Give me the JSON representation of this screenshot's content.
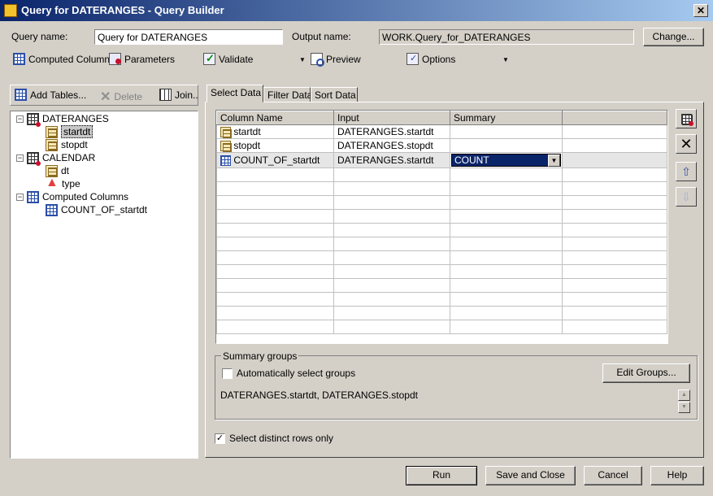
{
  "window": {
    "title": "Query for DATERANGES - Query Builder",
    "close": "✕"
  },
  "query": {
    "name_label": "Query name:",
    "name_value": "Query for DATERANGES",
    "output_label": "Output name:",
    "output_value": "WORK.Query_for_DATERANGES",
    "change_label": "Change..."
  },
  "toolbar": {
    "computed": "Computed Columns",
    "parameters": "Parameters",
    "validate": "Validate",
    "preview": "Preview",
    "options": "Options"
  },
  "left_toolbar": {
    "add": "Add Tables...",
    "delete": "Delete",
    "join": "Join.."
  },
  "tree": {
    "daterange": "DATERANGES",
    "startdt": "startdt",
    "stopdt": "stopdt",
    "calendar": "CALENDAR",
    "dt": "dt",
    "type": "type",
    "computed": "Computed Columns",
    "count": "COUNT_OF_startdt"
  },
  "tabs": {
    "select": "Select Data",
    "filter": "Filter Data",
    "sort": "Sort Data"
  },
  "grid": {
    "headers": [
      "Column Name",
      "Input",
      "Summary",
      ""
    ],
    "rows": [
      {
        "name": "startdt",
        "input": "DATERANGES.startdt",
        "summary": ""
      },
      {
        "name": "stopdt",
        "input": "DATERANGES.stopdt",
        "summary": ""
      },
      {
        "name": "COUNT_OF_startdt",
        "input": "DATERANGES.startdt",
        "summary": "COUNT"
      }
    ]
  },
  "summary": {
    "legend": "Summary groups",
    "auto_label": "Automatically select groups",
    "auto_checked": false,
    "edit_label": "Edit Groups...",
    "groups_text": "DATERANGES.startdt, DATERANGES.stopdt"
  },
  "distinct": {
    "label": "Select distinct rows only",
    "checked": true,
    "mark": "✓"
  },
  "footer": {
    "run": "Run",
    "save": "Save and Close",
    "cancel": "Cancel",
    "help": "Help"
  },
  "icons": {
    "window": "query-builder-icon",
    "side": [
      "table-search-icon",
      "remove-x-icon",
      "move-up-icon",
      "move-down-icon"
    ]
  },
  "colors": {
    "title_start": "#0a246a",
    "title_end": "#a6caf0",
    "face": "#d4d0c8",
    "select": "#0a246a"
  }
}
